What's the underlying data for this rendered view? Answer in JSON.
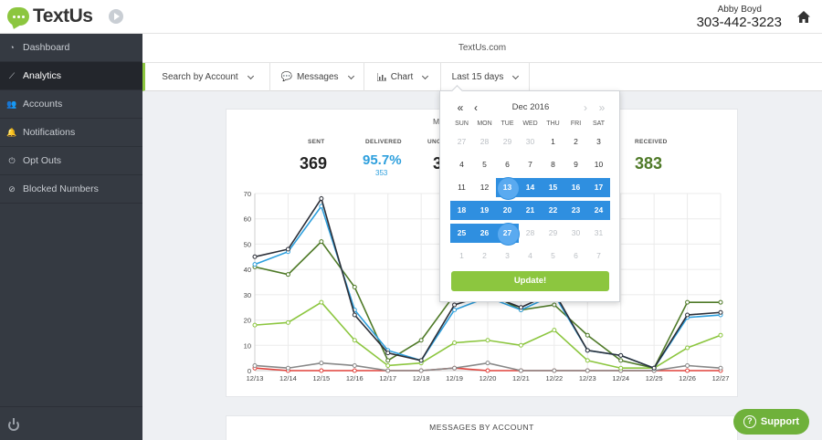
{
  "brand": {
    "name": "TextUs"
  },
  "user": {
    "name": "Abby Boyd",
    "phone": "303-442-3223"
  },
  "site": "TextUs.com",
  "sidebar": {
    "items": [
      {
        "label": "Dashboard",
        "icon": "dashboard-icon",
        "glyph": "◔"
      },
      {
        "label": "Analytics",
        "icon": "analytics-icon",
        "glyph": "⟋"
      },
      {
        "label": "Accounts",
        "icon": "accounts-icon",
        "glyph": "👥"
      },
      {
        "label": "Notifications",
        "icon": "bell-icon",
        "glyph": "🔔"
      },
      {
        "label": "Opt Outs",
        "icon": "opt-out-icon",
        "glyph": "⏻"
      },
      {
        "label": "Blocked Numbers",
        "icon": "blocked-icon",
        "glyph": "⊘"
      }
    ]
  },
  "filters": {
    "account": "Search by Account",
    "messages": "Messages",
    "chart": "Chart",
    "range": "Last 15 days"
  },
  "stats": {
    "title_fragment": "M",
    "sent": {
      "label": "SENT",
      "value": "369"
    },
    "delivered": {
      "label": "DELIVERED",
      "value": "95.7%",
      "sub": "353"
    },
    "undelivered": {
      "label_fragment": "UNC",
      "value_fragment": "3"
    },
    "received": {
      "label": "RECEIVED",
      "value": "383"
    }
  },
  "chart_data": {
    "type": "line",
    "categories": [
      "12/13",
      "12/14",
      "12/15",
      "12/16",
      "12/17",
      "12/18",
      "12/19",
      "12/20",
      "12/21",
      "12/22",
      "12/23",
      "12/24",
      "12/25",
      "12/26",
      "12/27"
    ],
    "ylim": [
      0,
      70
    ],
    "yticks": [
      0,
      10,
      20,
      30,
      40,
      50,
      60,
      70
    ],
    "grid": true,
    "series": [
      {
        "color": "#2c2f38",
        "values": [
          45,
          48,
          68,
          22,
          7,
          4,
          26,
          30,
          25,
          31,
          8,
          6,
          1,
          22,
          23
        ]
      },
      {
        "color": "#2d9fdd",
        "values": [
          42,
          47,
          65,
          24,
          8,
          4,
          24,
          29,
          24,
          30,
          8,
          6,
          1,
          21,
          22
        ]
      },
      {
        "color": "#4f7a28",
        "values": [
          41,
          38,
          51,
          33,
          4,
          12,
          30,
          31,
          24,
          26,
          14,
          4,
          1,
          27,
          27
        ]
      },
      {
        "color": "#8cc63f",
        "values": [
          18,
          19,
          27,
          12,
          2,
          3,
          11,
          12,
          10,
          16,
          4,
          1,
          1,
          9,
          14
        ]
      },
      {
        "color": "#888888",
        "values": [
          2,
          1,
          3,
          2,
          0,
          0,
          1,
          3,
          0,
          0,
          0,
          0,
          0,
          2,
          1
        ]
      },
      {
        "color": "#e0403a",
        "values": [
          1,
          0,
          0,
          0,
          0,
          0,
          1,
          0,
          0,
          0,
          0,
          0,
          0,
          0,
          0
        ]
      }
    ]
  },
  "datepicker": {
    "month": "Dec 2016",
    "nav": {
      "prev_year": "«",
      "prev": "‹",
      "next": "›",
      "next_year": "»"
    },
    "dow": [
      "SUN",
      "MON",
      "TUE",
      "WED",
      "THU",
      "FRI",
      "SAT"
    ],
    "weeks": [
      [
        "27",
        "28",
        "29",
        "30",
        "1",
        "2",
        "3"
      ],
      [
        "4",
        "5",
        "6",
        "7",
        "8",
        "9",
        "10"
      ],
      [
        "11",
        "12",
        "13",
        "14",
        "15",
        "16",
        "17"
      ],
      [
        "18",
        "19",
        "20",
        "21",
        "22",
        "23",
        "24"
      ],
      [
        "25",
        "26",
        "27",
        "28",
        "29",
        "30",
        "31"
      ],
      [
        "1",
        "2",
        "3",
        "4",
        "5",
        "6",
        "7"
      ]
    ],
    "update_label": "Update!"
  },
  "section2_title": "MESSAGES BY ACCOUNT",
  "support_label": "Support"
}
